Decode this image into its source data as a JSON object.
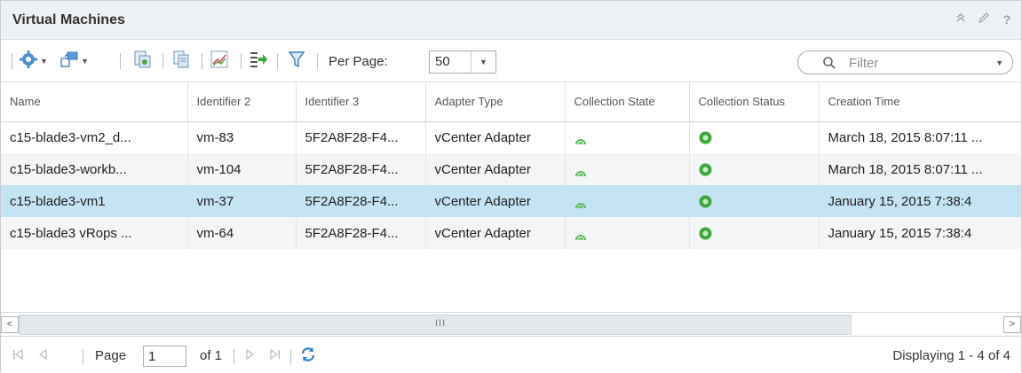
{
  "panel": {
    "title": "Virtual Machines",
    "header_icons": [
      "collapse-icon",
      "edit-icon",
      "help-icon"
    ]
  },
  "toolbar": {
    "buttons": [
      "gear-icon",
      "move-icon",
      "manage-icon",
      "copy-icon",
      "chart-icon",
      "export-icon",
      "filter-icon"
    ],
    "per_page_label": "Per Page:",
    "per_page_value": "50",
    "filter_placeholder": "Filter"
  },
  "table": {
    "columns": [
      "Name",
      "Identifier 2",
      "Identifier 3",
      "Adapter Type",
      "Collection State",
      "Collection Status",
      "Creation Time"
    ],
    "rows": [
      {
        "name": "c15-blade3-vm2_d...",
        "identifier2": "vm-83",
        "identifier3": "5F2A8F28-F4...",
        "adapter_type": "vCenter Adapter",
        "creation_time": "March 18, 2015 8:07:11 ..."
      },
      {
        "name": "c15-blade3-workb...",
        "identifier2": "vm-104",
        "identifier3": "5F2A8F28-F4...",
        "adapter_type": "vCenter Adapter",
        "creation_time": "March 18, 2015 8:07:11 ..."
      },
      {
        "name": "c15-blade3-vm1",
        "identifier2": "vm-37",
        "identifier3": "5F2A8F28-F4...",
        "adapter_type": "vCenter Adapter",
        "creation_time": "January 15, 2015 7:38:4"
      },
      {
        "name": "c15-blade3 vRops ...",
        "identifier2": "vm-64",
        "identifier3": "5F2A8F28-F4...",
        "adapter_type": "vCenter Adapter",
        "creation_time": "January 15, 2015 7:38:4"
      }
    ],
    "selected_row": 2
  },
  "scrollbar": {
    "grip": "III"
  },
  "footer": {
    "page_label": "Page",
    "page_value": "1",
    "of_label": "of 1",
    "displaying": "Displaying 1 - 4 of 4"
  },
  "colors": {
    "selected_row": "#c4e3f3",
    "state_icon": "#5cb85c",
    "status_icon": "#3fa63f"
  }
}
